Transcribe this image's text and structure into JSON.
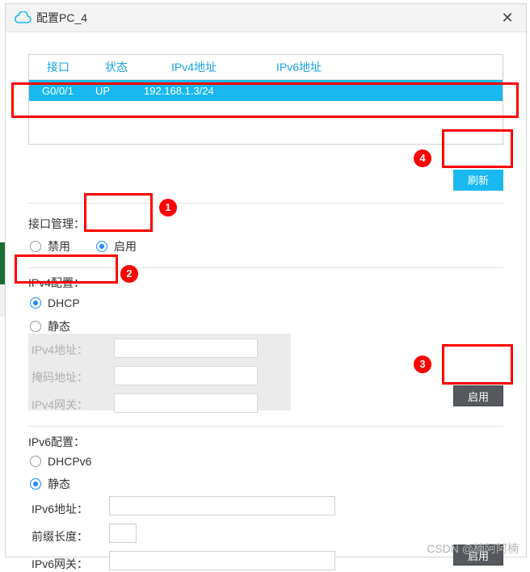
{
  "window": {
    "title": "配置PC_4",
    "icon": "cloud-icon",
    "close_label": "✕"
  },
  "table": {
    "headers": [
      "接口",
      "状态",
      "IPv4地址",
      "IPv6地址"
    ],
    "rows": [
      {
        "interface": "G0/0/1",
        "state": "UP",
        "ipv4": "192.168.1.3/24",
        "ipv6": ""
      }
    ]
  },
  "buttons": {
    "refresh": "刷新",
    "apply_ipv4": "启用",
    "apply_ipv6": "启用"
  },
  "interface_mgmt": {
    "title": "接口管理：",
    "disable_label": "禁用",
    "enable_label": "启用",
    "selected": "启用"
  },
  "ipv4": {
    "title": "IPv4配置：",
    "dhcp_label": "DHCP",
    "static_label": "静态",
    "selected": "DHCP",
    "address_label": "IPv4地址：",
    "address_value": "",
    "mask_label": "掩码地址：",
    "mask_value": "",
    "gateway_label": "IPv4网关：",
    "gateway_value": ""
  },
  "ipv6": {
    "title": "IPv6配置：",
    "dhcpv6_label": "DHCPv6",
    "static_label": "静态",
    "selected": "静态",
    "address_label": "IPv6地址：",
    "address_value": "",
    "prefix_label": "前缀长度：",
    "prefix_value": "",
    "gateway_label": "IPv6网关：",
    "gateway_value": ""
  },
  "annotations": {
    "markers": [
      "1",
      "2",
      "3",
      "4"
    ]
  },
  "watermark": "CSDN @楠阿阿楠",
  "colors": {
    "accent": "#19b9f0",
    "annotation": "#ff0000",
    "button": "#55585c",
    "header_text": "#1aa3e8"
  }
}
